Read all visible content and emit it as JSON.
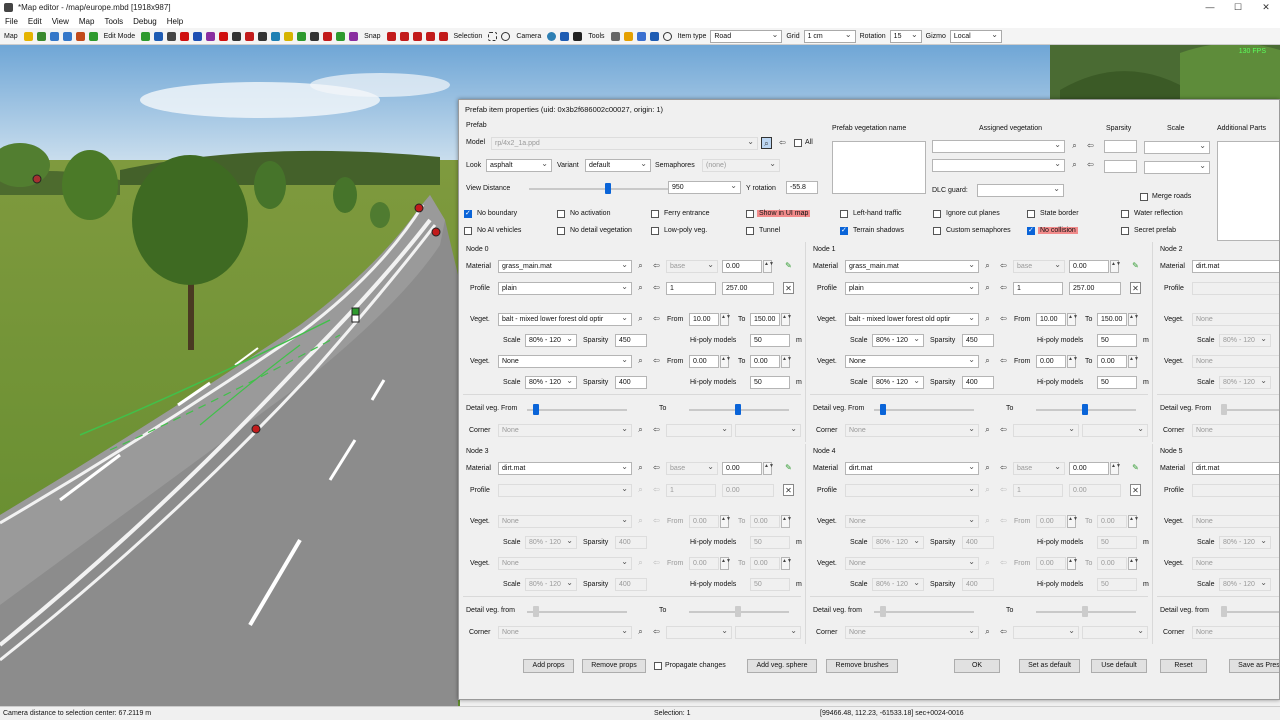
{
  "window": {
    "title": "*Map editor - /map/europe.mbd [1918x987]",
    "min": "—",
    "max": "☐",
    "close": "✕"
  },
  "menu": [
    "File",
    "Edit",
    "View",
    "Map",
    "Tools",
    "Debug",
    "Help"
  ],
  "toolbar": {
    "map": "Map",
    "edit_mode": "Edit Mode",
    "snap": "Snap",
    "selection": "Selection",
    "camera": "Camera",
    "tools": "Tools",
    "item_type": "Item type",
    "item_type_value": "Road",
    "grid": "Grid",
    "grid_value": "1 cm",
    "rotation": "Rotation",
    "rotation_value": "15",
    "gizmo": "Gizmo",
    "gizmo_value": "Local"
  },
  "fps": "130 FPS",
  "status": {
    "camera_distance": "Camera distance to selection center: 67.2119 m",
    "selection": "Selection: 1",
    "coords": "[99466.48, 112.23, -61533.18] sec+0024-0016"
  },
  "dialog": {
    "title": "Prefab item properties (uid: 0x3b2f686002c00027, origin: 1)",
    "prefab_section": "Prefab",
    "model_label": "Model",
    "model_value": "rp/4x2_1a.ppd",
    "all_label": "All",
    "look_label": "Look",
    "look_value": "asphalt",
    "variant_label": "Variant",
    "variant_value": "default",
    "semaphores_label": "Semaphores",
    "semaphores_value": "(none)",
    "view_distance_label": "View Distance",
    "view_distance_value": "950",
    "y_rotation_label": "Y rotation",
    "y_rotation_value": "-55.8",
    "veg_header": {
      "name": "Prefab vegetation name",
      "assigned": "Assigned vegetation",
      "sparsity": "Sparsity",
      "scale": "Scale",
      "additional": "Additional Parts"
    },
    "dlc_guard": "DLC guard:",
    "merge_roads": "Merge roads",
    "checks": [
      {
        "label": "No boundary",
        "on": true
      },
      {
        "label": "No activation",
        "on": false
      },
      {
        "label": "Ferry entrance",
        "on": false
      },
      {
        "label": "Show in UI map",
        "on": false,
        "red": true
      },
      {
        "label": "Left-hand traffic",
        "on": false
      },
      {
        "label": "Ignore cut planes",
        "on": false
      },
      {
        "label": "State border",
        "on": false
      },
      {
        "label": "Water reflection",
        "on": false
      },
      {
        "label": "No AI vehicles",
        "on": false
      },
      {
        "label": "No detail vegetation",
        "on": false
      },
      {
        "label": "Low-poly veg.",
        "on": false
      },
      {
        "label": "Tunnel",
        "on": false
      },
      {
        "label": "Terrain shadows",
        "on": true
      },
      {
        "label": "Custom semaphores",
        "on": false
      },
      {
        "label": "No collision",
        "on": true,
        "red": true
      },
      {
        "label": "Secret prefab",
        "on": false
      }
    ],
    "labels": {
      "material": "Material",
      "profile": "Profile",
      "veget": "Veget.",
      "scale": "Scale",
      "sparsity": "Sparsity",
      "from": "From",
      "to": "To",
      "hipoly": "Hi-poly models",
      "m": "m",
      "detail_from": "Detail veg. From",
      "detail_from2": "Detail veg. from",
      "to2": "To",
      "corner": "Corner",
      "none": "None",
      "base": "base"
    },
    "nodes": [
      {
        "name": "Node 0",
        "material": "grass_main.mat",
        "mat_val": "0.00",
        "profile": "plain",
        "p1": "1",
        "p2": "257.00",
        "veg1": "balt - mixed lower forest old optir",
        "veg1_from": "10.00",
        "veg1_to": "150.00",
        "veg1_scale": "80% - 120",
        "veg1_sparsity": "450",
        "veg1_hipoly": "50",
        "veg2": "None",
        "veg2_from": "0.00",
        "veg2_to": "0.00",
        "veg2_scale": "80% - 120",
        "veg2_sparsity": "400",
        "veg2_hipoly": "50",
        "active": true
      },
      {
        "name": "Node 1",
        "material": "grass_main.mat",
        "mat_val": "0.00",
        "profile": "plain",
        "p1": "1",
        "p2": "257.00",
        "veg1": "balt - mixed lower forest old optir",
        "veg1_from": "10.00",
        "veg1_to": "150.00",
        "veg1_scale": "80% - 120",
        "veg1_sparsity": "450",
        "veg1_hipoly": "50",
        "veg2": "None",
        "veg2_from": "0.00",
        "veg2_to": "0.00",
        "veg2_scale": "80% - 120",
        "veg2_sparsity": "400",
        "veg2_hipoly": "50",
        "active": true
      },
      {
        "name": "Node 2",
        "material": "dirt.mat",
        "profile": "",
        "veg1": "None",
        "veg1_scale": "80% - 120",
        "veg2": "None",
        "veg2_scale": "80% - 120"
      },
      {
        "name": "Node 3",
        "material": "dirt.mat",
        "mat_val": "0.00",
        "profile": "",
        "p1": "1",
        "p2": "0.00",
        "veg1": "None",
        "veg1_from": "0.00",
        "veg1_to": "0.00",
        "veg1_scale": "80% - 120",
        "veg1_sparsity": "400",
        "veg1_hipoly": "50",
        "veg2": "None",
        "veg2_from": "0.00",
        "veg2_to": "0.00",
        "veg2_scale": "80% - 120",
        "veg2_sparsity": "400",
        "veg2_hipoly": "50",
        "active": false
      },
      {
        "name": "Node 4",
        "material": "dirt.mat",
        "mat_val": "0.00",
        "profile": "",
        "p1": "1",
        "p2": "0.00",
        "veg1": "None",
        "veg1_from": "0.00",
        "veg1_to": "0.00",
        "veg1_scale": "80% - 120",
        "veg1_sparsity": "400",
        "veg1_hipoly": "50",
        "veg2": "None",
        "veg2_from": "0.00",
        "veg2_to": "0.00",
        "veg2_scale": "80% - 120",
        "veg2_sparsity": "400",
        "veg2_hipoly": "50",
        "active": false
      },
      {
        "name": "Node 5",
        "material": "dirt.mat",
        "profile": "",
        "veg1": "None",
        "veg1_scale": "80% - 120",
        "veg2": "None",
        "veg2_scale": "80% - 120"
      }
    ],
    "buttons": {
      "add_props": "Add props",
      "remove_props": "Remove props",
      "propagate": "Propagate changes",
      "add_veg_sphere": "Add veg. sphere",
      "remove_brushes": "Remove brushes",
      "ok": "OK",
      "set_default": "Set as default",
      "use_default": "Use default",
      "reset": "Reset",
      "save_preset": "Save as Pres"
    }
  }
}
